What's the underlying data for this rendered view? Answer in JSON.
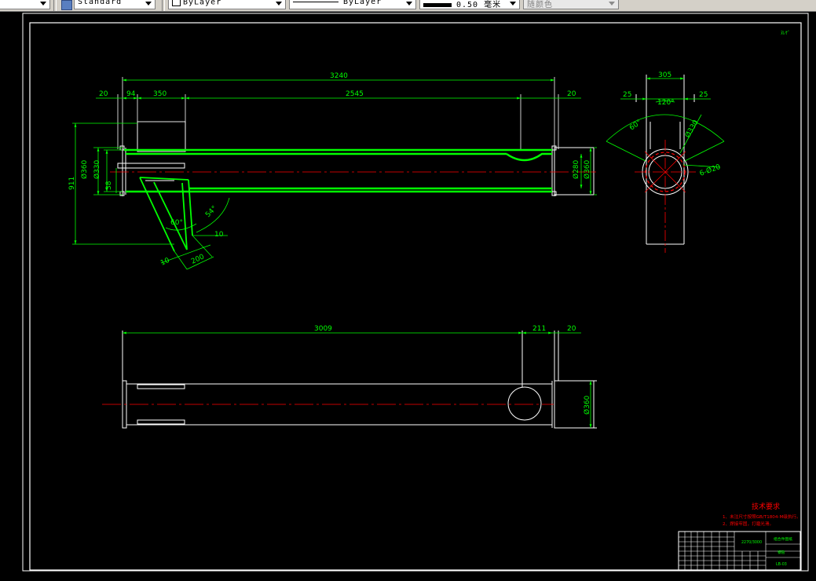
{
  "toolbar": {
    "text_style": "Standard",
    "layer": "ByLayer",
    "linetype": "ByLayer",
    "lineweight": "0.50 毫米",
    "plot_style": "随颜色"
  },
  "drawing": {
    "corner_tag": "ﾇﾚｹﾞ",
    "front_view": {
      "dim_overall": "3240",
      "dim_left_end": "20",
      "dim_94": "94",
      "dim_350": "350",
      "dim_2545": "2545",
      "dim_right_end": "20",
      "dim_height": "911",
      "dim_dia_360_left": "Ø360",
      "dim_dia_330_left": "Ø330",
      "dim_38": "38",
      "dim_dia_280": "Ø280",
      "dim_dia_360_right": "Ø360",
      "dim_angle_60": "60°",
      "dim_angle_54": "54°",
      "dim_10_right": "10",
      "dim_10_left": "10",
      "dim_200": "200"
    },
    "side_view": {
      "dim_305": "305",
      "dim_25_left": "25",
      "dim_25_right": "25",
      "dim_120": "120°",
      "dim_angle_60": "60°",
      "dim_dia_330": "Ø330",
      "dim_holes": "6-Ø20"
    },
    "top_view": {
      "dim_3009": "3009",
      "dim_211": "211",
      "dim_20": "20",
      "dim_dia_360": "Ø360"
    },
    "tech_requirements": {
      "title": "技术要求",
      "line1": "1、未注尺寸按照GB/T1804-M级执行。",
      "line2": "2、焊接牢固，打磨光滑。"
    },
    "title_block": {
      "center_text": "2270/3000",
      "right_top": "组合件图纸",
      "right_mid": "钢管",
      "right_bottom": "LB-03"
    }
  }
}
